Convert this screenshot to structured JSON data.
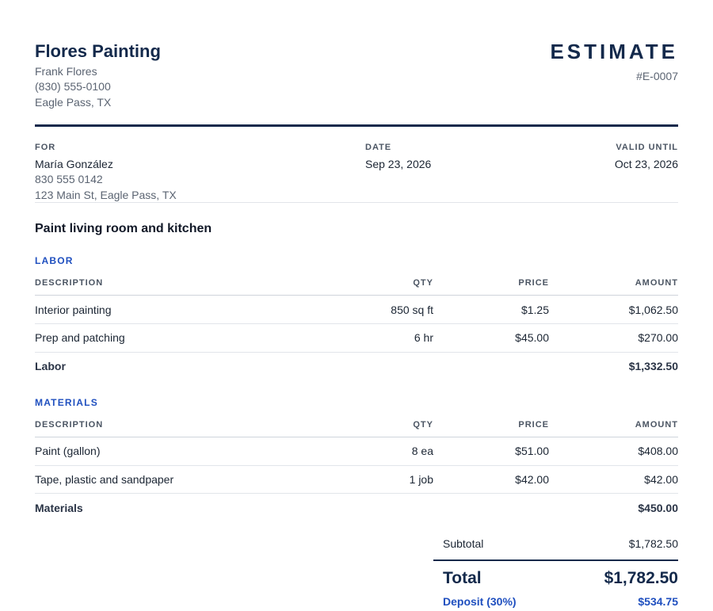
{
  "business": {
    "name": "Flores Painting",
    "owner": "Frank Flores",
    "phone": "(830) 555-0100",
    "location": "Eagle Pass, TX"
  },
  "document": {
    "title": "ESTIMATE",
    "number": "#E-0007"
  },
  "meta": {
    "for_label": "FOR",
    "client_name": "María González",
    "client_phone": "830 555 0142",
    "client_address": "123 Main St, Eagle Pass, TX",
    "date_label": "DATE",
    "date_value": "Sep 23, 2026",
    "valid_label": "VALID UNTIL",
    "valid_value": "Oct 23, 2026"
  },
  "job_title": "Paint living room and kitchen",
  "columns": {
    "description": "DESCRIPTION",
    "qty": "QTY",
    "price": "PRICE",
    "amount": "AMOUNT"
  },
  "sections": [
    {
      "title": "LABOR",
      "rows": [
        {
          "description": "Interior painting",
          "qty": "850 sq ft",
          "price": "$1.25",
          "amount": "$1,062.50"
        },
        {
          "description": "Prep and patching",
          "qty": "6 hr",
          "price": "$45.00",
          "amount": "$270.00"
        }
      ],
      "subtotal_label": "Labor",
      "subtotal_value": "$1,332.50"
    },
    {
      "title": "MATERIALS",
      "rows": [
        {
          "description": "Paint (gallon)",
          "qty": "8 ea",
          "price": "$51.00",
          "amount": "$408.00"
        },
        {
          "description": "Tape, plastic and sandpaper",
          "qty": "1 job",
          "price": "$42.00",
          "amount": "$42.00"
        }
      ],
      "subtotal_label": "Materials",
      "subtotal_value": "$450.00"
    }
  ],
  "totals": {
    "subtotal_label": "Subtotal",
    "subtotal_value": "$1,782.50",
    "total_label": "Total",
    "total_value": "$1,782.50",
    "deposit_label": "Deposit (30%)",
    "deposit_value": "$534.75"
  },
  "colors": {
    "navy": "#13294b",
    "accent_blue": "#1f4fbf",
    "muted_text": "#5b6472"
  }
}
